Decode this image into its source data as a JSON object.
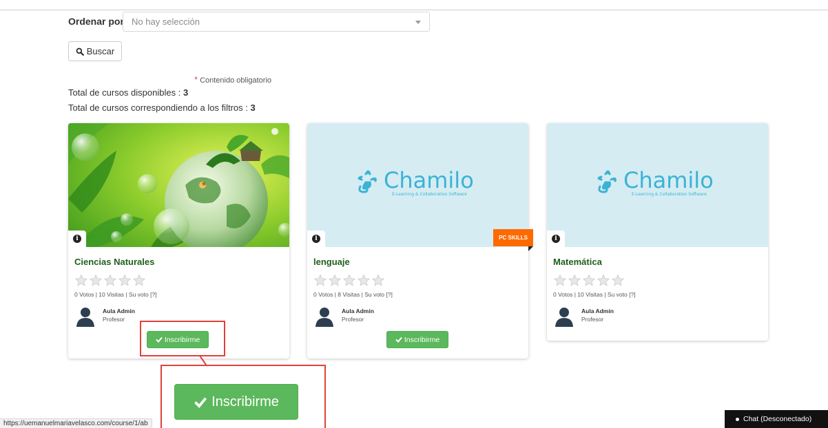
{
  "filter": {
    "sort_label": "Ordenar por",
    "sort_value": "No hay selección",
    "search_button": "Buscar"
  },
  "required_note": {
    "star": "*",
    "text": "Contenido obligatorio"
  },
  "totals": {
    "available_label": "Total de cursos disponibles : ",
    "available_value": "3",
    "filtered_label": "Total de cursos correspondiendo a los filtros : ",
    "filtered_value": "3"
  },
  "courses": [
    {
      "title": "Ciencias Naturales",
      "votes": "0 Votos | 10 Visitas | Su voto [?]",
      "teacher_name": "Aula Admin",
      "teacher_role": "Profesor",
      "enroll_label": "Inscribirme",
      "rating": 0
    },
    {
      "title": "lenguaje",
      "badge": "PC SKILLS",
      "votes": "0 Votos | 8 Visitas | Su voto [?]",
      "teacher_name": "Aula Admin",
      "teacher_role": "Profesor",
      "enroll_label": "Inscribirme",
      "rating": 0
    },
    {
      "title": "Matemática",
      "votes": "0 Votos | 10 Visitas | Su voto [?]",
      "teacher_name": "Aula Admin",
      "teacher_role": "Profesor",
      "rating": 0
    }
  ],
  "chamilo_logo": {
    "name": "Chamilo",
    "tagline": "E-Learning & Collaboration Software"
  },
  "zoom_callout": {
    "enroll_label": "Inscribirme"
  },
  "status_url": "https://uemanuelmariavelasco.com/course/1/ab",
  "chat_label": "Chat (Desconectado)",
  "colors": {
    "green": "#5cb85c",
    "title_green": "#1e5e1a",
    "highlight_red": "#e0403a",
    "badge_orange": "#ff6a00",
    "chamilo_bg": "#d5ecf3",
    "chamilo_blue": "#3bb3d4"
  },
  "icons": {
    "search": "magnifier",
    "info": "info-circle",
    "star": "star-outline",
    "check": "check",
    "avatar": "user-silhouette"
  }
}
